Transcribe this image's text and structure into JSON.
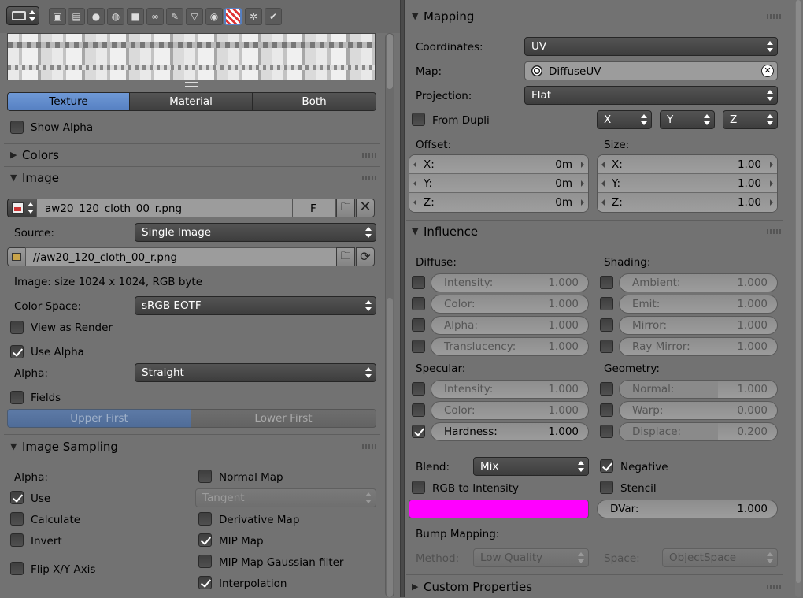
{
  "left": {
    "toolbar_icons": [
      "editor-type-icon",
      "render-icon",
      "render-layers-icon",
      "scene-icon",
      "world-icon",
      "object-icon",
      "constraints-icon",
      "modifiers-icon",
      "data-icon",
      "material-icon",
      "texture-icon",
      "particles-icon",
      "physics-icon"
    ],
    "preview_tabs": [
      "Texture",
      "Material",
      "Both"
    ],
    "active_preview_tab": "Texture",
    "show_alpha_label": "Show Alpha",
    "colors_panel": "Colors",
    "image_panel": "Image",
    "image_name": "aw20_120_cloth_00_r.png",
    "fake_user": "F",
    "source_label": "Source:",
    "source_value": "Single Image",
    "filepath": "//aw20_120_cloth_00_r.png",
    "image_info": "Image: size 1024 x 1024, RGB byte",
    "color_space_label": "Color Space:",
    "color_space_value": "sRGB EOTF",
    "view_as_render": "View as Render",
    "use_alpha": "Use Alpha",
    "alpha_label": "Alpha:",
    "alpha_value": "Straight",
    "fields": "Fields",
    "field_order": [
      "Upper First",
      "Lower First"
    ],
    "sampling_panel": "Image Sampling",
    "sampling_alpha_label": "Alpha:",
    "sampling_use": "Use",
    "sampling_calculate": "Calculate",
    "sampling_invert": "Invert",
    "flip_xy": "Flip X/Y Axis",
    "normal_map": "Normal Map",
    "normal_space": "Tangent",
    "derivative_map": "Derivative Map",
    "mip_map": "MIP Map",
    "mip_gauss": "MIP Map Gaussian filter",
    "interpolation": "Interpolation"
  },
  "right": {
    "mapping_panel": "Mapping",
    "coordinates_label": "Coordinates:",
    "coordinates_value": "UV",
    "map_label": "Map:",
    "map_value": "DiffuseUV",
    "projection_label": "Projection:",
    "projection_value": "Flat",
    "from_dupli": "From Dupli",
    "axes": [
      "X",
      "Y",
      "Z"
    ],
    "offset_label": "Offset:",
    "size_label": "Size:",
    "offset": [
      {
        "l": "X:",
        "v": "0m"
      },
      {
        "l": "Y:",
        "v": "0m"
      },
      {
        "l": "Z:",
        "v": "0m"
      }
    ],
    "size": [
      {
        "l": "X:",
        "v": "1.00"
      },
      {
        "l": "Y:",
        "v": "1.00"
      },
      {
        "l": "Z:",
        "v": "1.00"
      }
    ],
    "influence_panel": "Influence",
    "diffuse_label": "Diffuse:",
    "shading_label": "Shading:",
    "diffuse": [
      {
        "l": "Intensity:",
        "v": "1.000"
      },
      {
        "l": "Color:",
        "v": "1.000"
      },
      {
        "l": "Alpha:",
        "v": "1.000"
      },
      {
        "l": "Translucency:",
        "v": "1.000"
      }
    ],
    "shading": [
      {
        "l": "Ambient:",
        "v": "1.000"
      },
      {
        "l": "Emit:",
        "v": "1.000"
      },
      {
        "l": "Mirror:",
        "v": "1.000"
      },
      {
        "l": "Ray Mirror:",
        "v": "1.000"
      }
    ],
    "specular_label": "Specular:",
    "geometry_label": "Geometry:",
    "specular": [
      {
        "l": "Intensity:",
        "v": "1.000"
      },
      {
        "l": "Color:",
        "v": "1.000"
      },
      {
        "l": "Hardness:",
        "v": "1.000"
      }
    ],
    "geometry": [
      {
        "l": "Normal:",
        "v": "1.000"
      },
      {
        "l": "Warp:",
        "v": "0.000"
      },
      {
        "l": "Displace:",
        "v": "0.200"
      }
    ],
    "blend_label": "Blend:",
    "blend_value": "Mix",
    "negative": "Negative",
    "rgb_to_intensity": "RGB to Intensity",
    "stencil": "Stencil",
    "color_swatch": "#ff00ff",
    "dvar_label": "DVar:",
    "dvar_value": "1.000",
    "bump_label": "Bump Mapping:",
    "method_label": "Method:",
    "method_value": "Low Quality",
    "space_label": "Space:",
    "space_value": "ObjectSpace",
    "custom_props": "Custom Properties"
  }
}
